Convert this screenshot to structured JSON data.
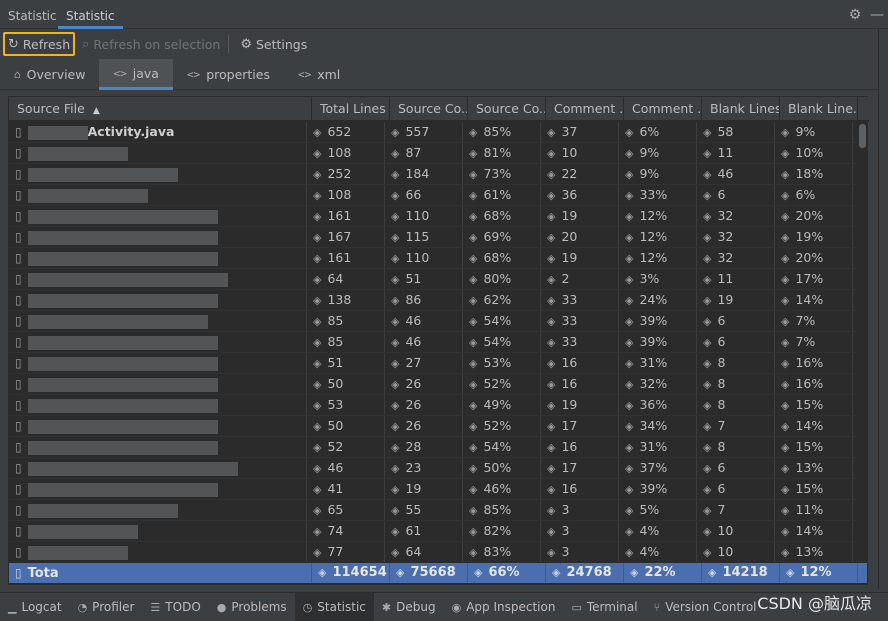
{
  "window_tabs": [
    "Statistic",
    "Statistic"
  ],
  "toolbar": {
    "refresh_label": "Refresh",
    "refresh_selection_label": "Refresh on selection",
    "settings_label": "Settings"
  },
  "panel_tabs": [
    {
      "label": "Overview",
      "icon": "home-icon"
    },
    {
      "label": "java",
      "icon": "code-icon"
    },
    {
      "label": "properties",
      "icon": "code-icon"
    },
    {
      "label": "xml",
      "icon": "code-icon"
    }
  ],
  "columns": [
    "Source File",
    "Total Lines",
    "Source Co...",
    "Source Co...",
    "Comment ...",
    "Comment ...",
    "Blank Lines",
    "Blank Line..."
  ],
  "rows": [
    {
      "file": "Activity.java",
      "values": [
        "652",
        "557",
        "85%",
        "37",
        "6%",
        "58",
        "9%"
      ]
    },
    {
      "file": "",
      "values": [
        "108",
        "87",
        "81%",
        "10",
        "9%",
        "11",
        "10%"
      ]
    },
    {
      "file": "",
      "values": [
        "252",
        "184",
        "73%",
        "22",
        "9%",
        "46",
        "18%"
      ]
    },
    {
      "file": "",
      "values": [
        "108",
        "66",
        "61%",
        "36",
        "33%",
        "6",
        "6%"
      ]
    },
    {
      "file": "",
      "values": [
        "161",
        "110",
        "68%",
        "19",
        "12%",
        "32",
        "20%"
      ]
    },
    {
      "file": "",
      "values": [
        "167",
        "115",
        "69%",
        "20",
        "12%",
        "32",
        "19%"
      ]
    },
    {
      "file": "",
      "values": [
        "161",
        "110",
        "68%",
        "19",
        "12%",
        "32",
        "20%"
      ]
    },
    {
      "file": "",
      "values": [
        "64",
        "51",
        "80%",
        "2",
        "3%",
        "11",
        "17%"
      ]
    },
    {
      "file": "",
      "values": [
        "138",
        "86",
        "62%",
        "33",
        "24%",
        "19",
        "14%"
      ]
    },
    {
      "file": "",
      "values": [
        "85",
        "46",
        "54%",
        "33",
        "39%",
        "6",
        "7%"
      ]
    },
    {
      "file": "",
      "values": [
        "85",
        "46",
        "54%",
        "33",
        "39%",
        "6",
        "7%"
      ]
    },
    {
      "file": "",
      "values": [
        "51",
        "27",
        "53%",
        "16",
        "31%",
        "8",
        "16%"
      ]
    },
    {
      "file": "",
      "values": [
        "50",
        "26",
        "52%",
        "16",
        "32%",
        "8",
        "16%"
      ]
    },
    {
      "file": "",
      "values": [
        "53",
        "26",
        "49%",
        "19",
        "36%",
        "8",
        "15%"
      ]
    },
    {
      "file": "",
      "values": [
        "50",
        "26",
        "52%",
        "17",
        "34%",
        "7",
        "14%"
      ]
    },
    {
      "file": "",
      "values": [
        "52",
        "28",
        "54%",
        "16",
        "31%",
        "8",
        "15%"
      ]
    },
    {
      "file": "",
      "values": [
        "46",
        "23",
        "50%",
        "17",
        "37%",
        "6",
        "13%"
      ]
    },
    {
      "file": "",
      "values": [
        "41",
        "19",
        "46%",
        "16",
        "39%",
        "6",
        "15%"
      ]
    },
    {
      "file": "",
      "values": [
        "65",
        "55",
        "85%",
        "3",
        "5%",
        "7",
        "11%"
      ]
    },
    {
      "file": "",
      "values": [
        "74",
        "61",
        "82%",
        "3",
        "4%",
        "10",
        "14%"
      ]
    },
    {
      "file": "",
      "values": [
        "77",
        "64",
        "83%",
        "3",
        "4%",
        "10",
        "13%"
      ]
    }
  ],
  "total": {
    "label": "Tota",
    "values": [
      "114654",
      "75668",
      "66%",
      "24768",
      "22%",
      "14218",
      "12%"
    ]
  },
  "statusbar": [
    {
      "label": "Logcat",
      "icon": "logcat-icon"
    },
    {
      "label": "Profiler",
      "icon": "profiler-icon"
    },
    {
      "label": "TODO",
      "icon": "todo-icon"
    },
    {
      "label": "Problems",
      "icon": "problems-icon"
    },
    {
      "label": "Statistic",
      "icon": "statistic-icon"
    },
    {
      "label": "Debug",
      "icon": "debug-icon"
    },
    {
      "label": "App Inspection",
      "icon": "app-inspection-icon"
    },
    {
      "label": "Terminal",
      "icon": "terminal-icon"
    },
    {
      "label": "Version Control",
      "icon": "version-control-icon"
    }
  ],
  "watermark": "CSDN @脑瓜凉",
  "colors": {
    "accent": "#4a88c7",
    "selection": "#4b6eaf",
    "focus": "#f0b41c",
    "background": "#2b2b2b"
  }
}
